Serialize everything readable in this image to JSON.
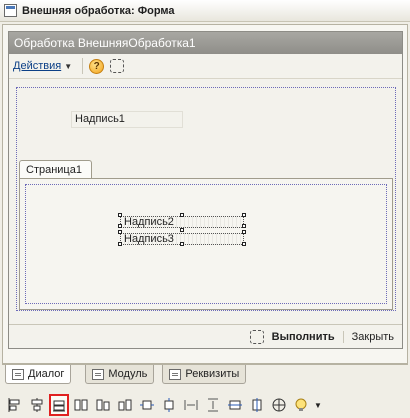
{
  "window": {
    "title": "Внешняя обработка: Форма"
  },
  "form": {
    "header_title": "Обработка  ВнешняяОбработка1",
    "toolbar": {
      "actions_label": "Действия",
      "help_icon_char": "?"
    },
    "label1": "Надпись1",
    "tab_label": "Страница1",
    "label2": "Надпись2",
    "label3": "Надпись3",
    "footer": {
      "run_label": "Выполнить",
      "close_label": "Закрыть"
    }
  },
  "bottom_tabs": [
    {
      "label": "Диалог",
      "active": true
    },
    {
      "label": "Модуль",
      "active": false
    },
    {
      "label": "Реквизиты",
      "active": false
    }
  ],
  "toolbar_icons": [
    "align-left-icon",
    "align-center-icon",
    "align-right-icon",
    "align-top-icon",
    "align-middle-icon",
    "align-bottom-icon",
    "center-horizontal-icon",
    "center-vertical-icon",
    "distribute-horizontal-icon",
    "distribute-vertical-icon",
    "same-width-icon",
    "same-height-icon",
    "grid-icon",
    "hint-icon"
  ],
  "colors": {
    "selected_outline": "#e02020",
    "form_header_bg": "#9b9a95",
    "link_blue": "#0b3f86",
    "dotted_border": "#6d6bb8"
  }
}
